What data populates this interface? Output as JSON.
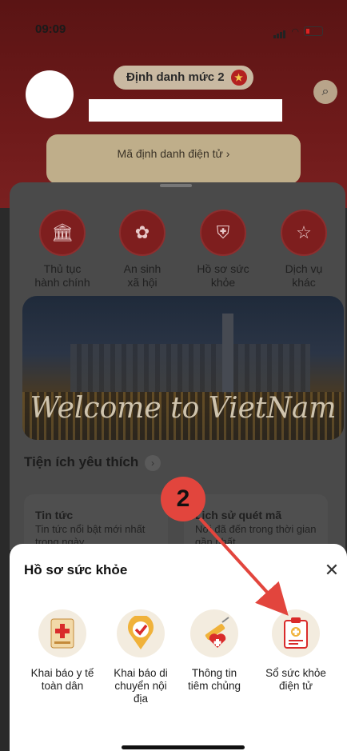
{
  "status": {
    "time": "09:09"
  },
  "header": {
    "level_label": "Định danh mức 2",
    "id_card_label": "Mã định danh điện tử  ›"
  },
  "services": [
    {
      "icon": "building-icon",
      "label": "Thủ tục\nhành chính"
    },
    {
      "icon": "social-icon",
      "label": "An sinh\nxã hội"
    },
    {
      "icon": "health-shield-icon",
      "label": "Hồ sơ sức\nkhỏe"
    },
    {
      "icon": "more-services-icon",
      "label": "Dịch vụ\nkhác"
    }
  ],
  "banner": {
    "caption": "Welcome to VietNam"
  },
  "favorites": {
    "title": "Tiện ích yêu thích",
    "cards": [
      {
        "title": "Tin tức",
        "desc": "Tin tức nổi bật mới nhất trong ngày"
      },
      {
        "title": "Lịch sử quét mã",
        "desc": "Nơi đã đến trong thời gian gần nhất"
      }
    ]
  },
  "sheet": {
    "title": "Hồ sơ sức khỏe",
    "options": [
      {
        "icon": "medical-declaration-icon",
        "label": "Khai báo y tế\ntoàn dân"
      },
      {
        "icon": "domestic-travel-icon",
        "label": "Khai báo di\nchuyển nội\nđịa"
      },
      {
        "icon": "vaccination-icon",
        "label": "Thông tin\ntiêm chủng"
      },
      {
        "icon": "health-book-icon",
        "label": "Sổ sức khỏe\nđiện tử"
      }
    ]
  },
  "annotation": {
    "step_number": "2",
    "color": "#e2453d"
  },
  "colors": {
    "brand_red": "#b32020",
    "header_dark": "#5a1414"
  }
}
